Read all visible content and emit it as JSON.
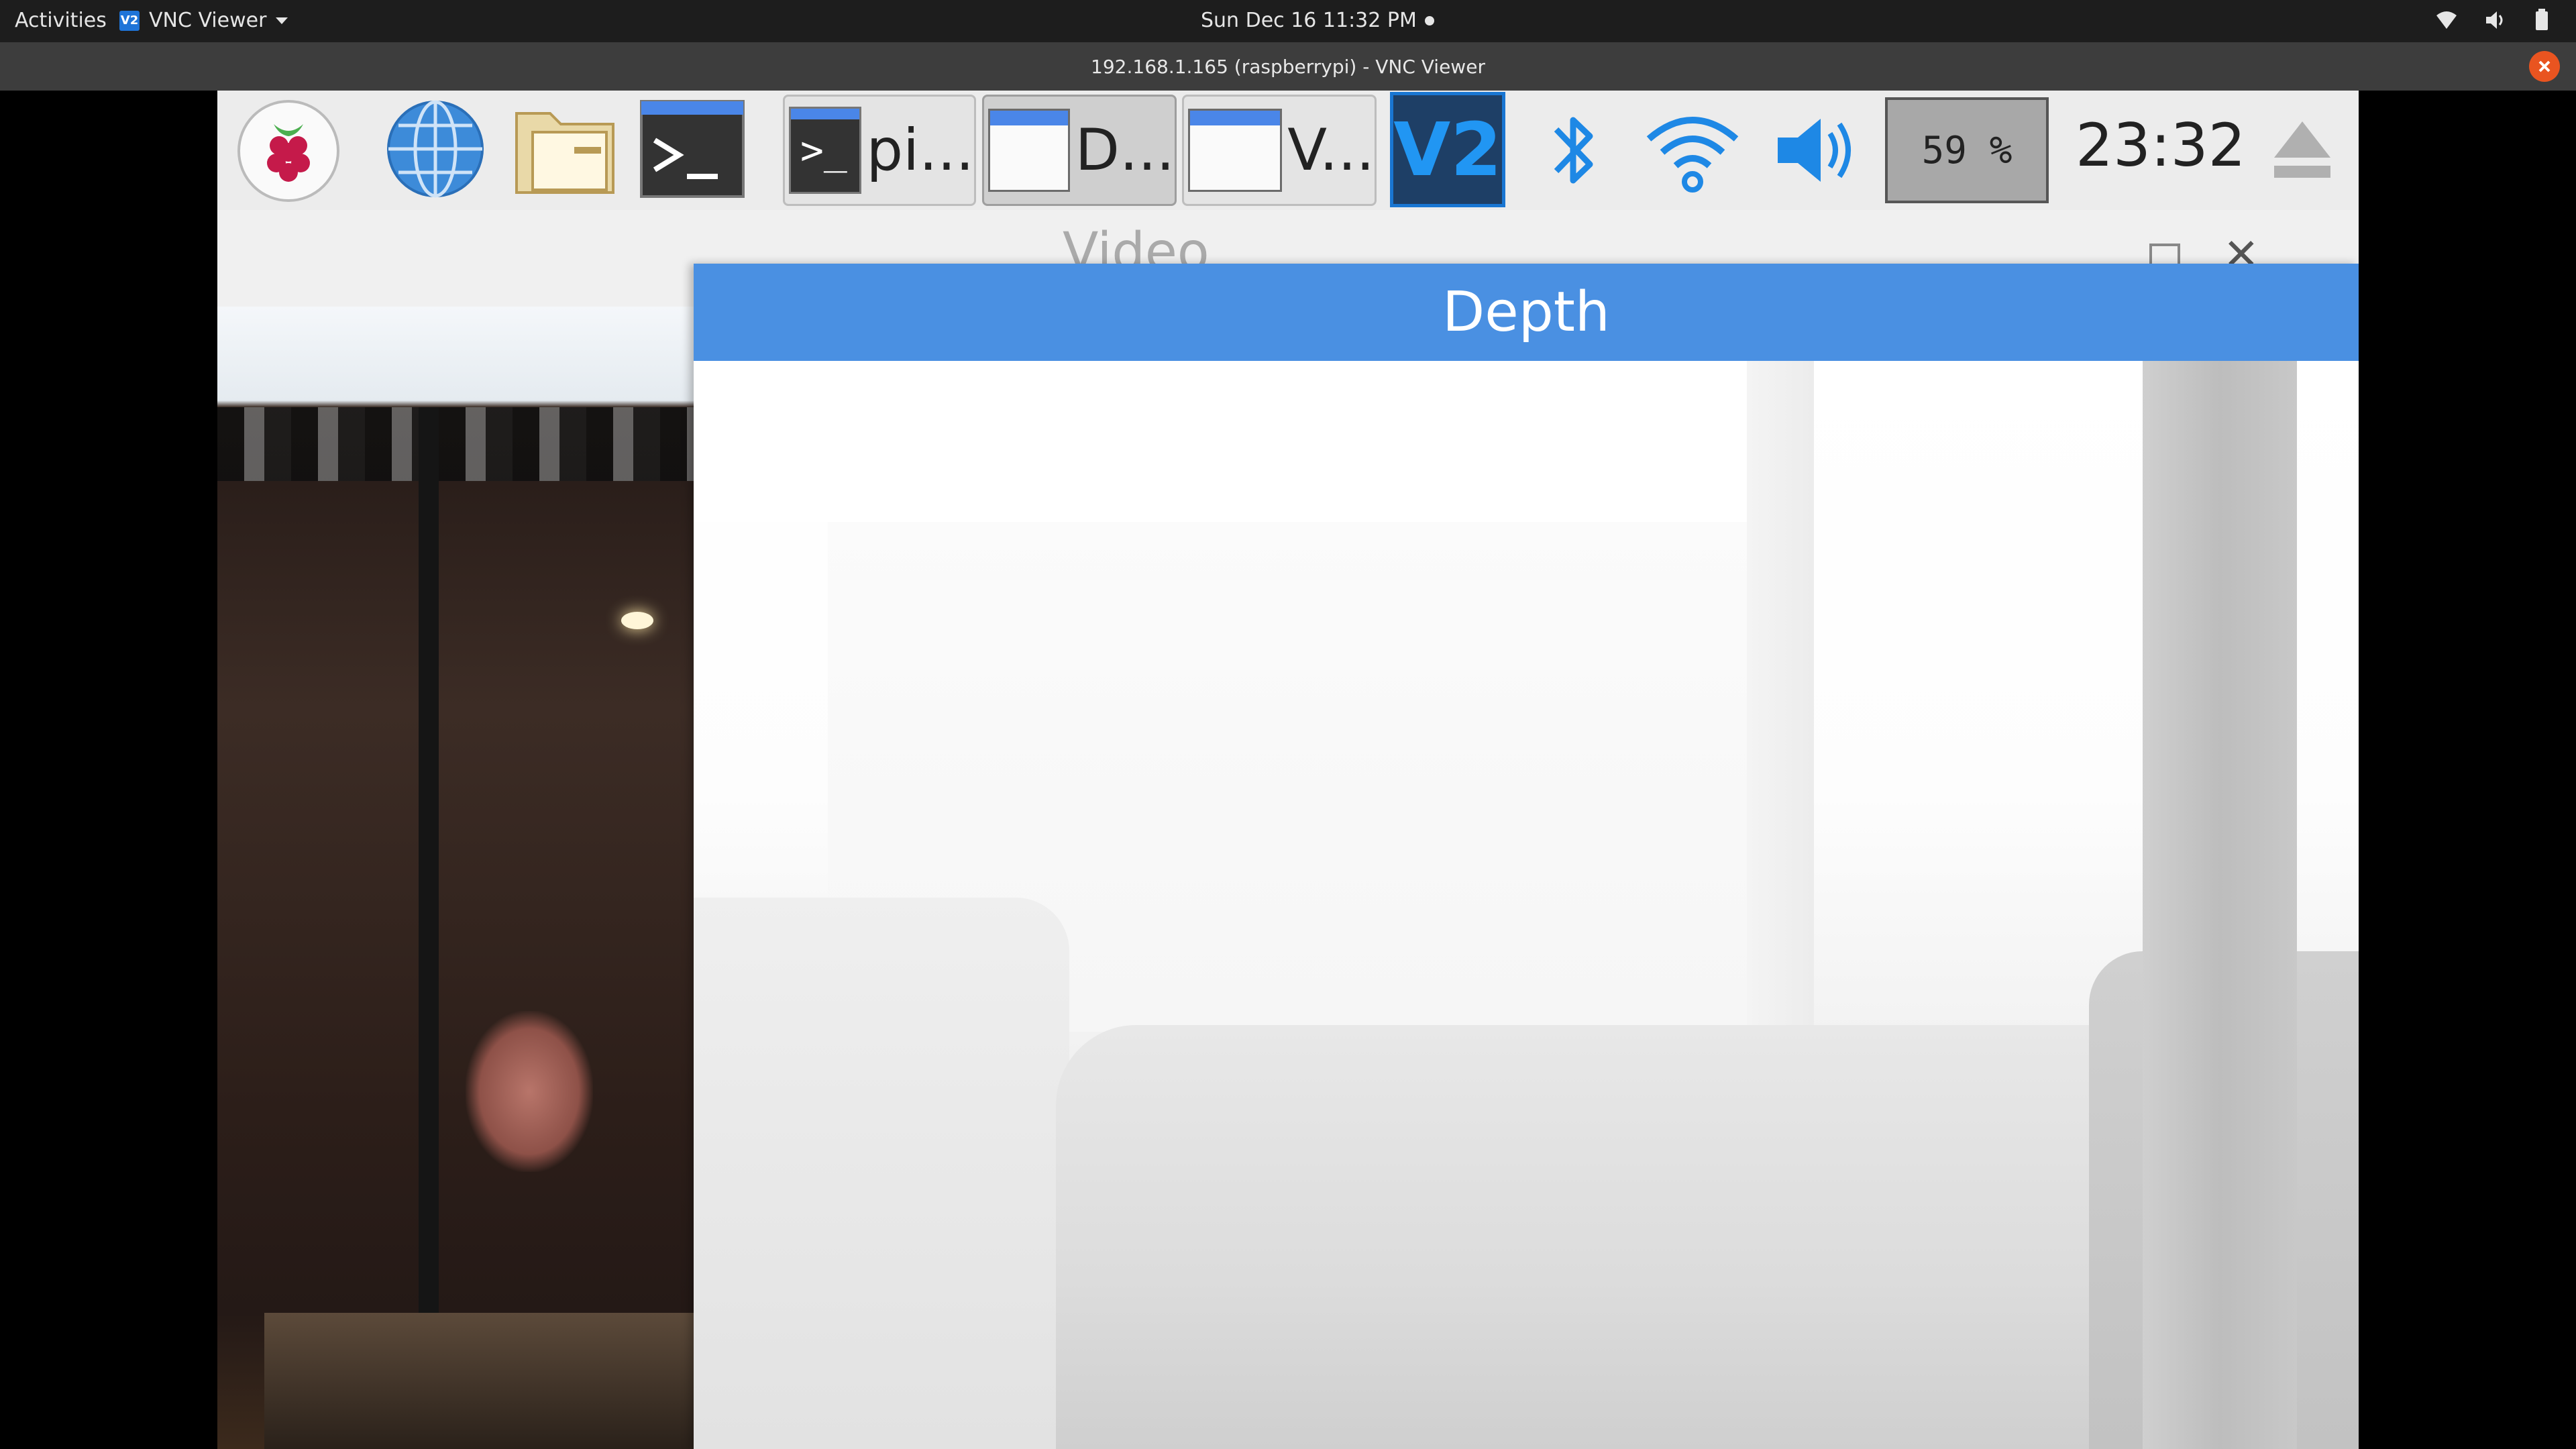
{
  "gnome_bar": {
    "activities": "Activities",
    "app_name": "VNC Viewer",
    "app_icon_text": "V2",
    "datetime": "Sun Dec 16  11:32 PM"
  },
  "window": {
    "title": "192.168.1.165 (raspberrypi) - VNC Viewer"
  },
  "panel": {
    "tasks": [
      {
        "label": "pi..."
      },
      {
        "label": "D..."
      },
      {
        "label": "V..."
      }
    ],
    "terminal_prompt": ">_",
    "vnc_tray_text": "V2",
    "cpu_usage": "59 %",
    "clock": "23:32"
  },
  "video_window": {
    "title": "Video"
  },
  "depth_window": {
    "title": "Depth"
  },
  "colors": {
    "accent": "#4a90e2",
    "close_button": "#e95420",
    "vnc_blue": "#1976d2"
  }
}
